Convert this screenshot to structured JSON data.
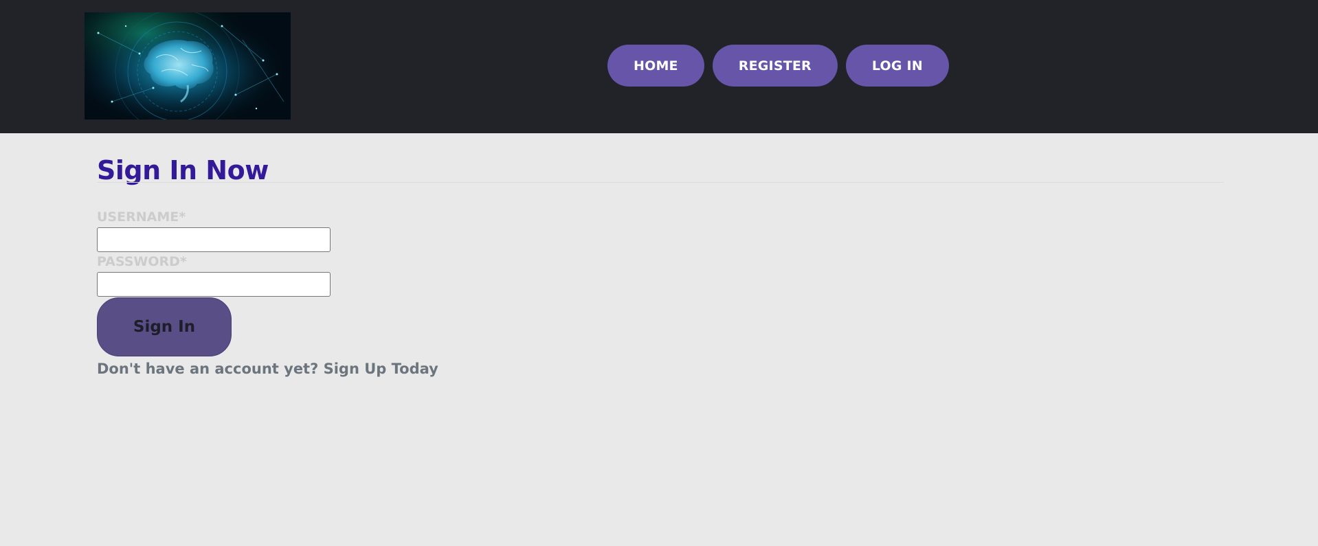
{
  "header": {
    "logo_alt": "brain-tech-logo",
    "nav": [
      {
        "label": "HOME"
      },
      {
        "label": "REGISTER"
      },
      {
        "label": "LOG IN"
      }
    ]
  },
  "form": {
    "title": "Sign In Now",
    "username_label": "USERNAME*",
    "username_value": "",
    "password_label": "PASSWORD*",
    "password_value": "",
    "submit_label": "Sign In",
    "signup_prompt": "Don't have an account yet? ",
    "signup_link": "Sign Up Today"
  },
  "colors": {
    "header_bg": "#212328",
    "page_bg": "#e9e9e9",
    "nav_button": "#6655a8",
    "title": "#331a99",
    "submit_button": "#5a4e87",
    "muted_text": "#6c757d",
    "label_text": "#cccccc"
  }
}
